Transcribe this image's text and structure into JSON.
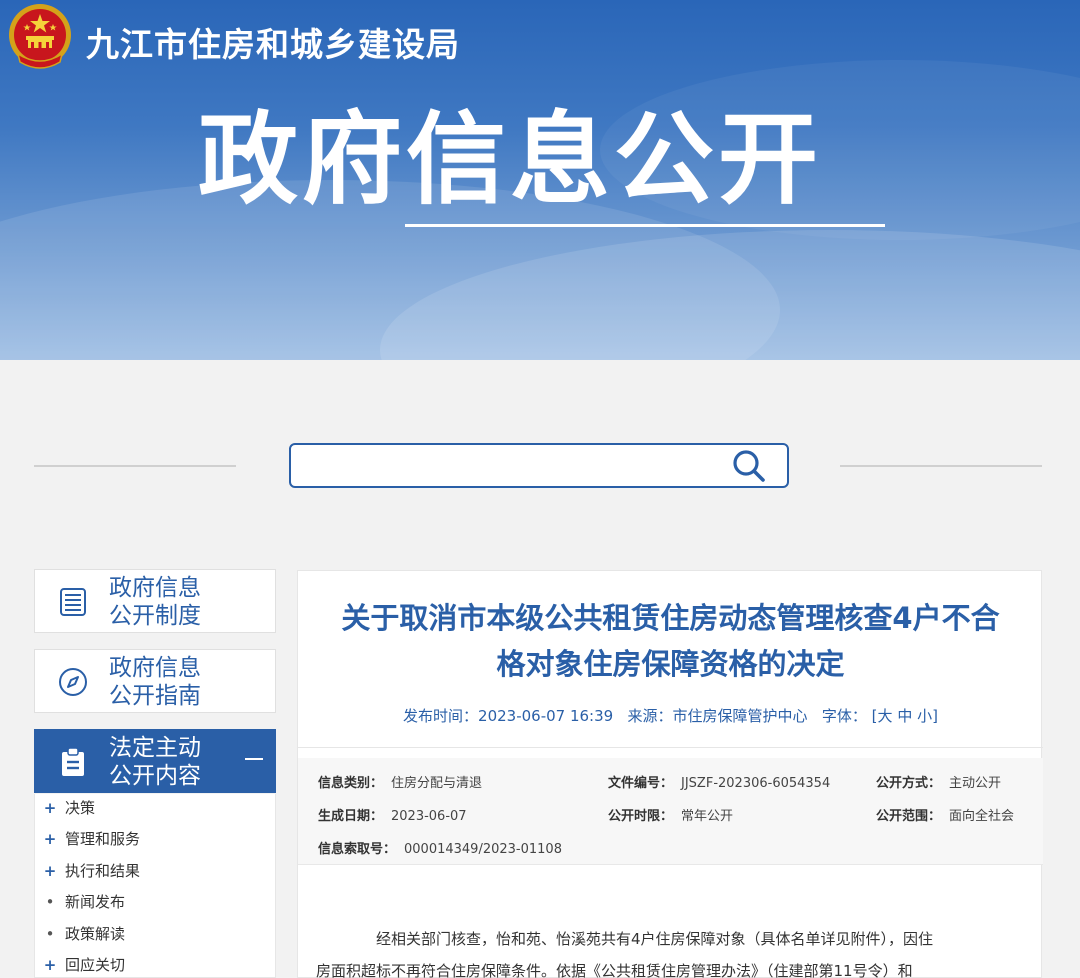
{
  "header": {
    "site_name": "九江市住房和城乡建设局",
    "hero_title": "政府信息公开",
    "emblem_icon": "national-emblem-icon"
  },
  "search": {
    "placeholder": "",
    "icon": "search-icon"
  },
  "sidebar": {
    "items": [
      {
        "label_line1": "政府信息",
        "label_line2": "公开制度",
        "icon": "document-list-icon"
      },
      {
        "label_line1": "政府信息",
        "label_line2": "公开指南",
        "icon": "compass-icon"
      },
      {
        "label_line1": "法定主动",
        "label_line2": "公开内容",
        "icon": "clipboard-icon",
        "active": true
      }
    ],
    "sub_items": [
      {
        "marker": "+",
        "label": "决策"
      },
      {
        "marker": "+",
        "label": "管理和服务"
      },
      {
        "marker": "+",
        "label": "执行和结果"
      },
      {
        "marker": "•",
        "label": "新闻发布"
      },
      {
        "marker": "•",
        "label": "政策解读"
      },
      {
        "marker": "+",
        "label": "回应关切"
      }
    ]
  },
  "article": {
    "title_line1": "关于取消市本级公共租赁住房动态管理核查4户不合",
    "title_line2": "格对象住房保障资格的决定",
    "publish_label": "发布时间：",
    "publish_time": "2023-06-07 16:39",
    "source_label": "来源：",
    "source": "市住房保障管护中心",
    "font_label": "字体：",
    "font_open": "[",
    "font_large": "大",
    "font_medium": "中",
    "font_small": "小",
    "font_close": "]",
    "info": {
      "category_label": "信息类别：",
      "category": "住房分配与清退",
      "doc_no_label": "文件编号：",
      "doc_no": "JJSZF-202306-6054354",
      "method_label": "公开方式：",
      "method": "主动公开",
      "date_label": "生成日期：",
      "date": "2023-06-07",
      "period_label": "公开时限：",
      "period": "常年公开",
      "scope_label": "公开范围：",
      "scope": "面向全社会",
      "index_label": "信息索取号：",
      "index": "000014349/2023-01108"
    },
    "body_line1": "经相关部门核查，怡和苑、怡溪苑共有4户住房保障对象（具体名单详见附件），因住",
    "body_line2": "房面积超标不再符合住房保障条件。依据《公共租赁住房管理办法》（住建部第11号令）和"
  },
  "colors": {
    "primary": "#2a5fa7",
    "banner_top": "#2a66b8",
    "banner_bottom": "#9dbde3",
    "page_bg": "#f2f2f2"
  }
}
